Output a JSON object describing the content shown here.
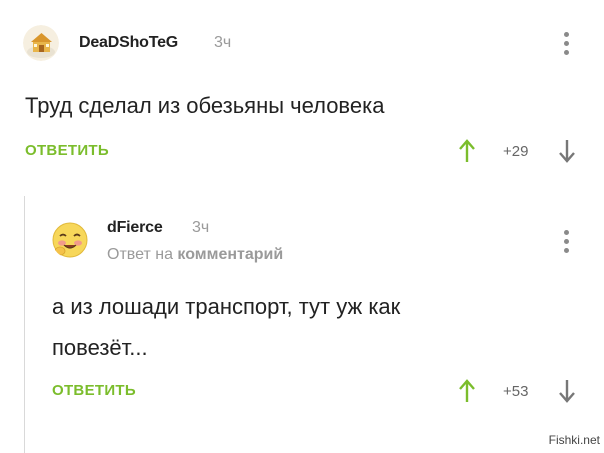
{
  "comment": {
    "username": "DeaDShoTeG",
    "time": "3ч",
    "text": "Труд сделал из обезьяны человека",
    "reply_label": "ОТВЕТИТЬ",
    "rating": "+29",
    "avatar_icon": "house-avatar-icon"
  },
  "reply": {
    "username": "dFierce",
    "time": "3ч",
    "reply_prefix": "Ответ на",
    "reply_target": "комментарий",
    "text_line1": "а из лошади транспорт, тут уж как",
    "text_line2": "повезёт...",
    "reply_label": "ОТВЕТИТЬ",
    "rating": "+53",
    "avatar_icon": "smiley-avatar-icon"
  },
  "colors": {
    "accent_green": "#7bbd2c",
    "muted_gray": "#9a9a9a",
    "text": "#222222"
  },
  "watermark": "Fishki.net"
}
